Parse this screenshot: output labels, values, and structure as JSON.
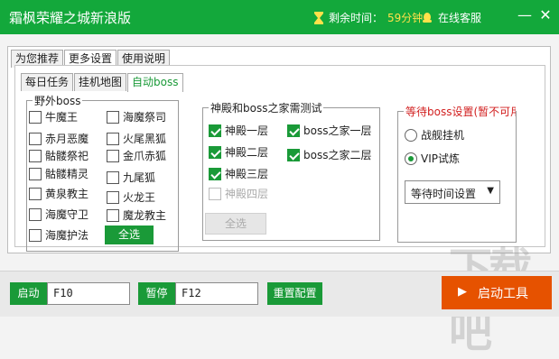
{
  "window": {
    "title": "霜枫荣耀之城新浪版"
  },
  "header": {
    "timer_label": "剩余时间：",
    "timer_value": "59分钟",
    "service_label": "在线客服"
  },
  "tabs": [
    "为您推荐",
    "更多设置",
    "使用说明"
  ],
  "subtabs": [
    "每日任务",
    "挂机地图",
    "自动boss"
  ],
  "wild_boss": {
    "title": "野外boss",
    "items": [
      {
        "label": "牛魔王",
        "checked": false
      },
      {
        "label": "海魔祭司",
        "checked": false
      },
      {
        "label": "赤月恶魔",
        "checked": false
      },
      {
        "label": "火尾黑狐",
        "checked": false
      },
      {
        "label": "骷髅祭祀",
        "checked": false
      },
      {
        "label": "金爪赤狐",
        "checked": false
      },
      {
        "label": "骷髅精灵",
        "checked": false
      },
      {
        "label": "九尾狐",
        "checked": false
      },
      {
        "label": "黄泉教主",
        "checked": false
      },
      {
        "label": "火龙王",
        "checked": false
      },
      {
        "label": "海魔守卫",
        "checked": false
      },
      {
        "label": "魔龙教主",
        "checked": false
      },
      {
        "label": "海魔护法",
        "checked": false
      }
    ],
    "select_all": "全选"
  },
  "temple": {
    "title": "神殿和boss之家需测试",
    "items": [
      {
        "label": "神殿一层",
        "checked": true
      },
      {
        "label": "boss之家一层",
        "checked": true
      },
      {
        "label": "神殿二层",
        "checked": true
      },
      {
        "label": "boss之家二层",
        "checked": true
      },
      {
        "label": "神殿三层",
        "checked": true
      },
      {
        "label": "神殿四层",
        "checked": false,
        "disabled": true
      }
    ],
    "select_all": "全选"
  },
  "wait": {
    "title": "等待boss设置(暂不可用)",
    "options": [
      {
        "label": "战舰挂机",
        "selected": false
      },
      {
        "label": "VIP试炼",
        "selected": true
      }
    ],
    "select_value": "等待时间设置"
  },
  "footer": {
    "start_label": "启动",
    "start_key": "F10",
    "pause_label": "暂停",
    "pause_key": "F12",
    "reset_label": "重置配置",
    "launch_label": "启动工具"
  },
  "colors": {
    "brand": "#13a83b",
    "button": "#1a9a38",
    "accent": "#e65200",
    "title_red": "#d22020"
  }
}
